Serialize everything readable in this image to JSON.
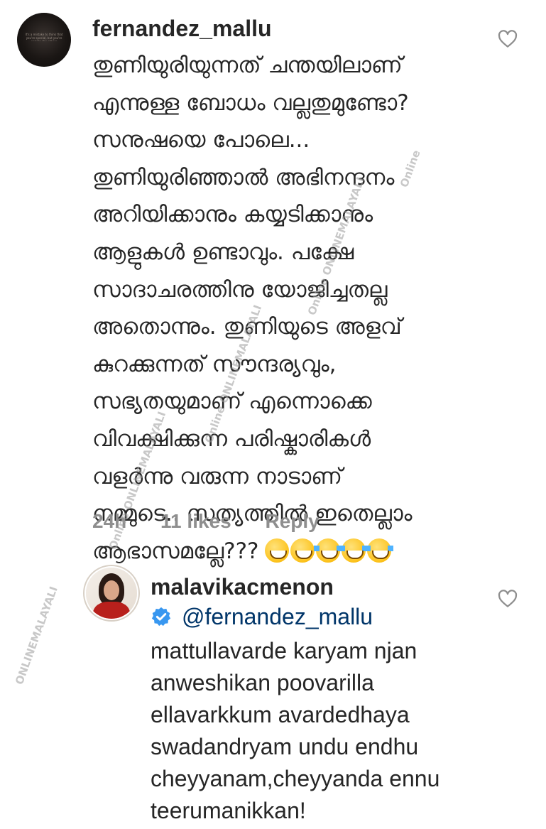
{
  "comment": {
    "username": "fernandez_mallu",
    "avatar_text": "It's a mistake to think that you're special, but you're not like the others",
    "lines": [
      "തുണിയുരിയുന്നത് ചന്തയിലാണ്",
      "എന്നുള്ള ബോധം വല്ലതുമുണ്ടോ?",
      "സനുഷയെ പോലെ...",
      "തുണിയുരിഞ്ഞാൽ അഭിനന്ദനം",
      "അറിയിക്കാനും കയ്യടിക്കാനും",
      "ആളുകൾ ഉണ്ടാവും. പക്ഷേ",
      "സാദാചരത്തിനു യോജിച്ചതല്ല",
      "അതൊന്നും. തുണിയുടെ അളവ്",
      "കുറക്കുന്നത് സൗന്ദര്യവും,",
      "സഭ്യതയുമാണ് എന്നൊക്കെ",
      "വിവക്ഷിക്കുന്ന പരിഷ്കാരികൾ",
      "വളർന്നു വരുന്ന നാടാണ്",
      "നമ്മുടെ.. സത്യത്തിൽ ഇതെല്ലാം",
      "ആഭാസമല്ലേ???"
    ],
    "emoji_names": [
      "grinning-face",
      "grinning-face",
      "tears-of-joy",
      "tears-of-joy",
      "tears-of-joy"
    ],
    "time": "24h",
    "likes": "11 likes",
    "reply_label": "Reply"
  },
  "reply": {
    "username": "malavikacmenon",
    "verified_icon": "verified-badge-icon",
    "mention": "@fernandez_mallu",
    "lines": [
      "mattullavarde karyam njan",
      "anweshikan poovarilla",
      "ellavarkkum avardedhaya",
      "swadandryam undu endhu",
      "cheyyanam,cheyyanda ennu",
      "teerumanikkan!"
    ]
  },
  "watermark": {
    "text": "ONLINEMALAYALI",
    "badge": "Online"
  },
  "colors": {
    "text": "#262626",
    "secondary": "#8e8e8e",
    "verified": "#3897f0",
    "mention": "#003569"
  }
}
